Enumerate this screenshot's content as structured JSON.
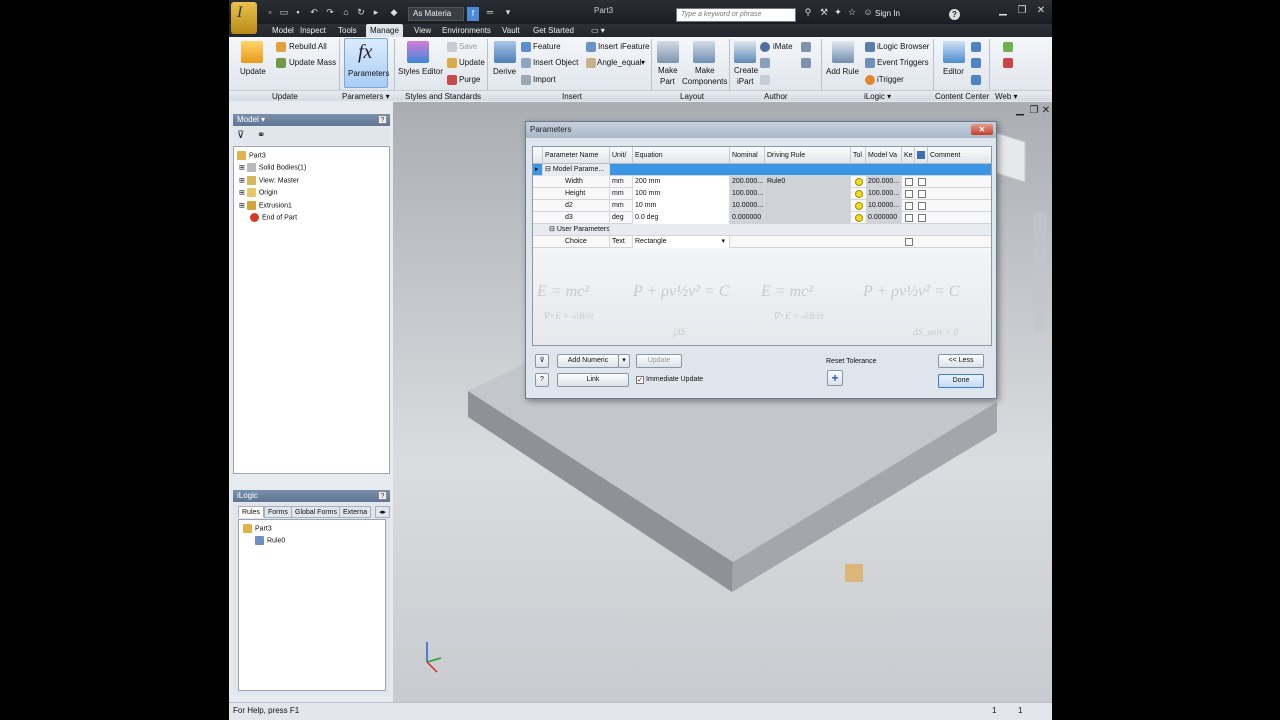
{
  "titlebar": {
    "material": "As Materia",
    "document_title": "Part3",
    "search_placeholder": "Type a keyword or phrase",
    "sign_in": "Sign In",
    "help": "?"
  },
  "tabs": [
    "Model",
    "Inspect",
    "Tools",
    "Manage",
    "View",
    "Environments",
    "Vault",
    "Get Started"
  ],
  "ribbon": {
    "update": "Update",
    "rebuild_all": "Rebuild All",
    "update_mass": "Update Mass",
    "parameters": "Parameters",
    "styles_editor": "Styles Editor",
    "save": "Save",
    "update_small": "Update",
    "purge": "Purge",
    "derive": "Derive",
    "feature": "Feature",
    "insert_object": "Insert Object",
    "import": "Import",
    "insert_ifeature": "Insert iFeature",
    "angle_equal": "Angle_equal",
    "make_part": "Make Part",
    "make_part_l1": "Make",
    "make_part_l2": "Part",
    "make_components_l1": "Make",
    "make_components_l2": "Components",
    "create_ipart_l1": "Create",
    "create_ipart_l2": "iPart",
    "imate": "iMate",
    "add_rule": "Add Rule",
    "ilogic_browser": "iLogic Browser",
    "event_triggers": "Event Triggers",
    "itrigger": "iTrigger",
    "editor": "Editor",
    "groups": {
      "update": "Update",
      "parameters": "Parameters ▾",
      "styles": "Styles and Standards",
      "insert": "Insert",
      "layout": "Layout",
      "author": "Author",
      "ilogic": "iLogic ▾",
      "content_center": "Content Center",
      "web": "Web ▾"
    }
  },
  "model_browser": {
    "title": "Model ▾",
    "items": [
      "Part3",
      "Solid Bodies(1)",
      "View: Master",
      "Origin",
      "Extrusion1",
      "End of Part"
    ]
  },
  "ilogic_browser": {
    "title": "iLogic",
    "tabs": [
      "Rules",
      "Forms",
      "Global Forms",
      "Externa"
    ],
    "items": [
      "Part3",
      "Rule0"
    ]
  },
  "status": {
    "help": "For Help, press F1",
    "n1": "1",
    "n2": "1"
  },
  "dialog": {
    "title": "Parameters",
    "columns": [
      "Parameter Name",
      "Unit/",
      "Equation",
      "Nominal",
      "Driving Rule",
      "Tol",
      "Model Va",
      "Ke",
      "",
      "Comment"
    ],
    "model_params_label": "Model Parame...",
    "user_params_label": "User Parameters",
    "rows": [
      {
        "name": "Width",
        "unit": "mm",
        "equation": "200 mm",
        "nominal": "200.000...",
        "rule": "Rule0",
        "model": "200.000..."
      },
      {
        "name": "Height",
        "unit": "mm",
        "equation": "100 mm",
        "nominal": "100.000...",
        "rule": "",
        "model": "100.000..."
      },
      {
        "name": "d2",
        "unit": "mm",
        "equation": "10 mm",
        "nominal": "10.0000...",
        "rule": "",
        "model": "10.0000..."
      },
      {
        "name": "d3",
        "unit": "deg",
        "equation": "0.0 deg",
        "nominal": "0.000000",
        "rule": "",
        "model": "0.000000"
      }
    ],
    "user_row": {
      "name": "Choice",
      "unit": "Text",
      "equation": "Rectangle"
    },
    "watermark": [
      "E = mc²",
      "P + ρv½v² = C",
      "E = mc²",
      "P + ρv½v² = C",
      "∇×E = -∂B/∂t",
      "∇×E = -∂B/∂t",
      "∫ΔS",
      "ΔS_univ > 0"
    ],
    "add_numeric": "Add Numeric",
    "update": "Update",
    "link": "Link",
    "immediate_update": "Immediate Update",
    "reset_tolerance": "Reset Tolerance",
    "less": "<< Less",
    "done": "Done"
  }
}
